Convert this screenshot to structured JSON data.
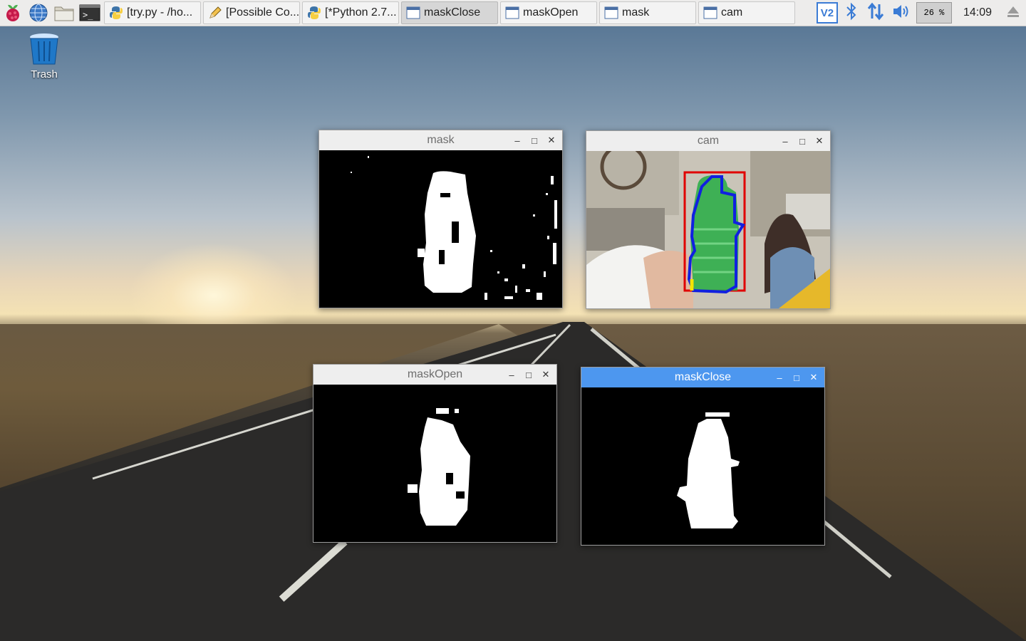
{
  "taskbar": {
    "tasks": [
      {
        "label": "[try.py - /ho...",
        "icon": "python-icon"
      },
      {
        "label": "[Possible Co...",
        "icon": "pencil-icon"
      },
      {
        "label": "[*Python 2.7...",
        "icon": "python-icon"
      },
      {
        "label": "maskClose",
        "icon": "window-icon"
      },
      {
        "label": "maskOpen",
        "icon": "window-icon"
      },
      {
        "label": "mask",
        "icon": "window-icon"
      },
      {
        "label": "cam",
        "icon": "window-icon"
      }
    ],
    "tray": {
      "vnc": "V2",
      "cpu": "26 %",
      "clock": "14:09"
    }
  },
  "desktop": {
    "trash_label": "Trash"
  },
  "windows": {
    "mask": {
      "title": "mask"
    },
    "cam": {
      "title": "cam"
    },
    "maskOpen": {
      "title": "maskOpen"
    },
    "maskClose": {
      "title": "maskClose"
    }
  },
  "colors": {
    "taskbar_bg": "#edeceb",
    "focused_title": "#4d97ef",
    "bbox_red": "#e00000",
    "contour_blue": "#1020e0",
    "bottle_green": "#2fae4a"
  }
}
